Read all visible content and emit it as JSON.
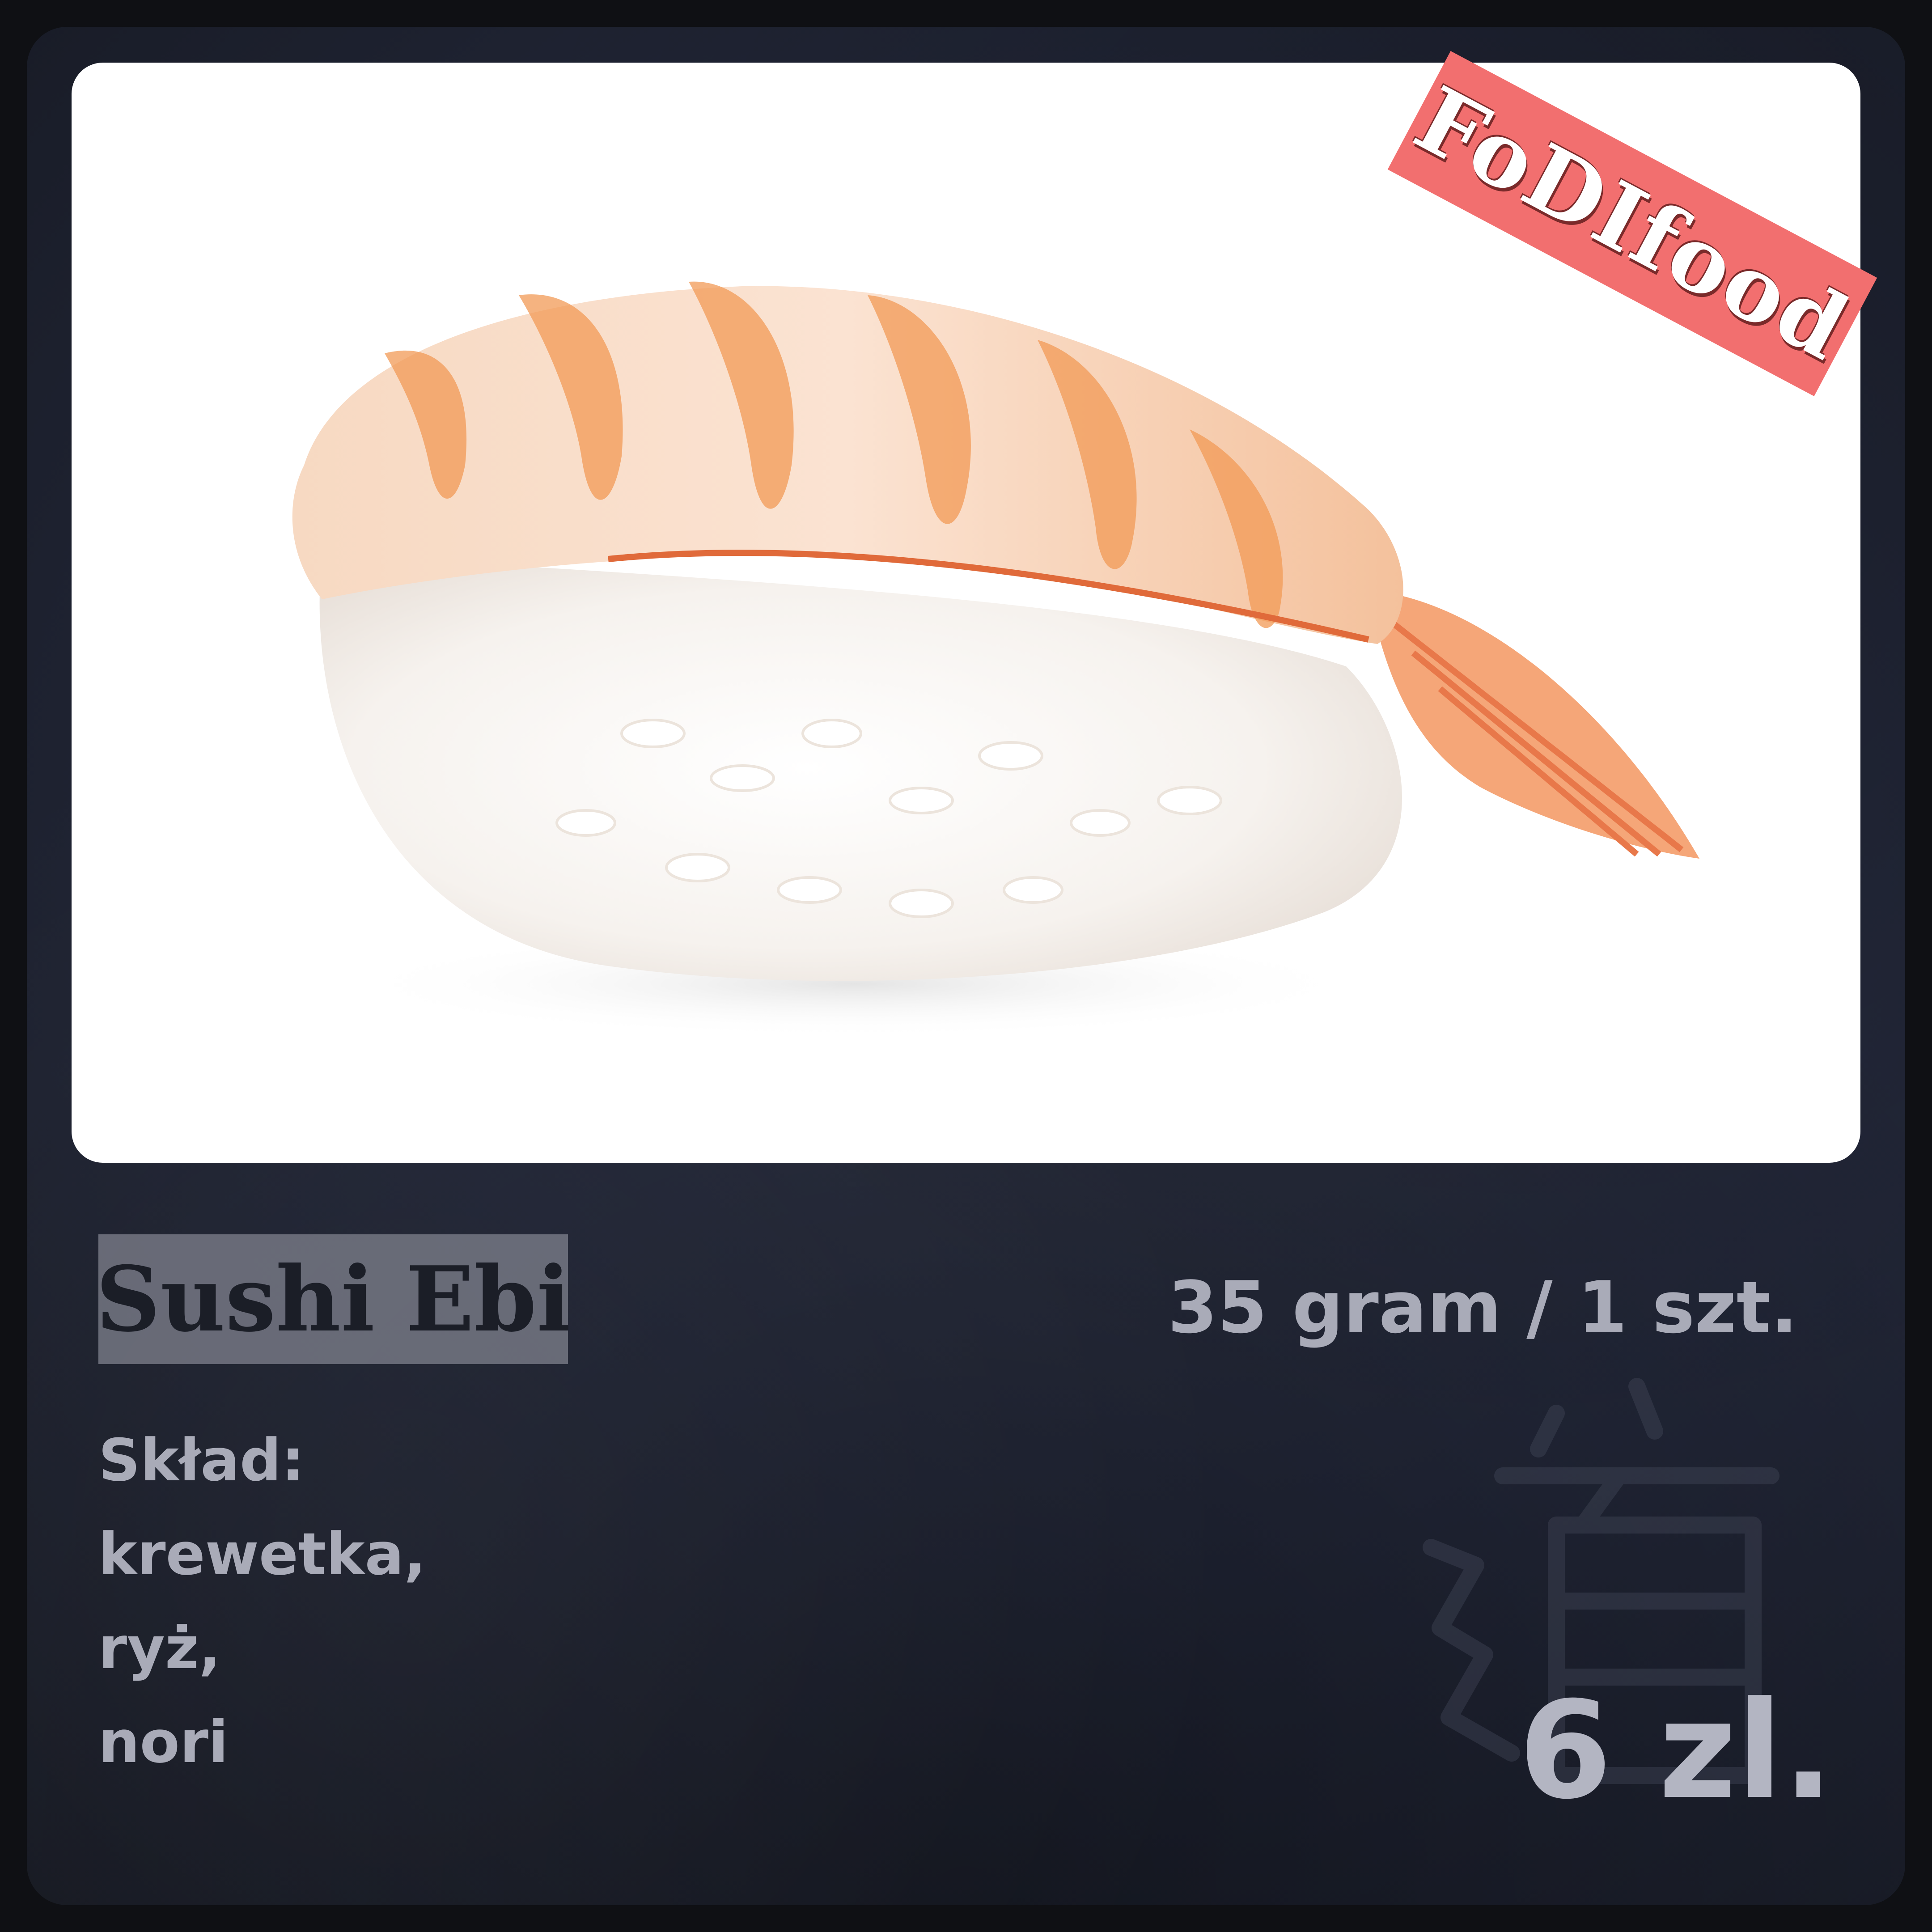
{
  "product": {
    "name": "Sushi Ebi",
    "weight": "35 gram / 1 szt.",
    "composition_label": "Skład:",
    "ingredients": [
      "krewetka,",
      "ryż,",
      "nori"
    ],
    "price": "6 zl."
  },
  "logo": {
    "text": "FoDIfood"
  },
  "photo": {
    "subject": "ebi-nigiri-sushi-image"
  },
  "colors": {
    "background": "#23283a",
    "logo_badge": "#f26f6f",
    "text_muted": "#a9abb8",
    "title_box": "#787a86"
  }
}
